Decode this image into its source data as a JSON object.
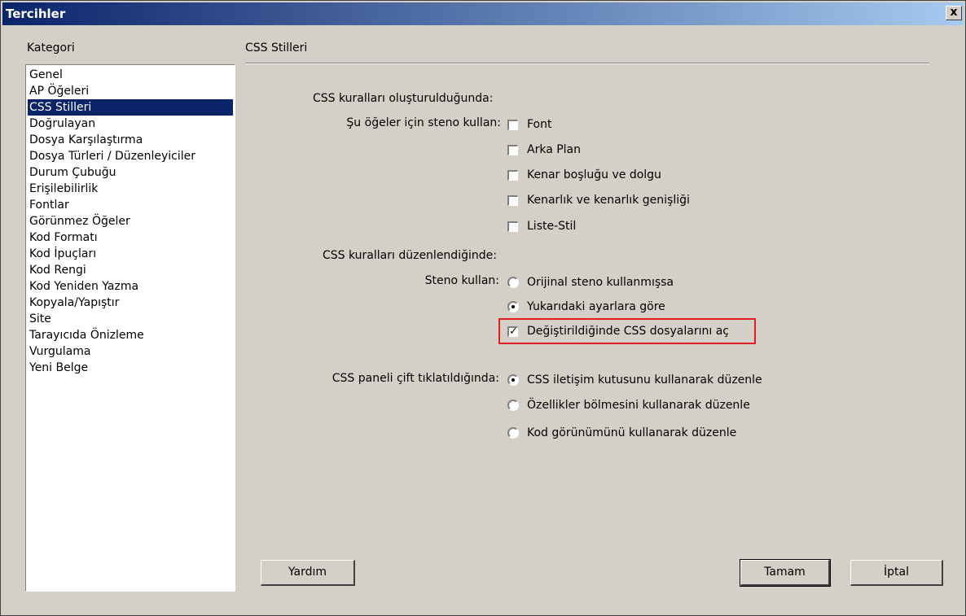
{
  "window": {
    "title": "Tercihler",
    "close_label": "x"
  },
  "category": {
    "label": "Kategori",
    "items": [
      "Genel",
      "AP Öğeleri",
      "CSS Stilleri",
      "Doğrulayan",
      "Dosya Karşılaştırma",
      "Dosya Türleri / Düzenleyiciler",
      "Durum Çubuğu",
      "Erişilebilirlik",
      "Fontlar",
      "Görünmez Öğeler",
      "Kod Formatı",
      "Kod İpuçları",
      "Kod Rengi",
      "Kod Yeniden Yazma",
      "Kopyala/Yapıştır",
      "Site",
      "Tarayıcıda Önizleme",
      "Vurgulama",
      "Yeni Belge"
    ],
    "selected": "CSS Stilleri"
  },
  "panel": {
    "title": "CSS Stilleri",
    "create_heading": "CSS kuralları oluşturulduğunda:",
    "shorthand_label": "Şu öğeler için steno kullan:",
    "shorthand_options": [
      {
        "label": "Font",
        "checked": false
      },
      {
        "label": "Arka Plan",
        "checked": false
      },
      {
        "label": "Kenar boşluğu ve dolgu",
        "checked": false
      },
      {
        "label": "Kenarlık ve kenarlık genişliği",
        "checked": false
      },
      {
        "label": "Liste-Stil",
        "checked": false
      }
    ],
    "edit_heading": "CSS kuralları düzenlendiğinde:",
    "steno_label": "Steno kullan:",
    "steno_options": [
      {
        "label": "Orijinal steno kullanmışsa",
        "checked": false
      },
      {
        "label": "Yukarıdaki ayarlara göre",
        "checked": true
      }
    ],
    "open_css_label": "Değiştirildiğinde CSS dosyalarını aç",
    "open_css_checked": true,
    "dblclick_label": "CSS paneli çift tıklatıldığında:",
    "dblclick_options": [
      {
        "label": "CSS iletişim kutusunu kullanarak düzenle",
        "checked": true
      },
      {
        "label": "Özellikler bölmesini kullanarak düzenle",
        "checked": false
      },
      {
        "label": "Kod görünümünü kullanarak düzenle",
        "checked": false
      }
    ]
  },
  "buttons": {
    "help": "Yardım",
    "ok": "Tamam",
    "cancel": "İptal"
  },
  "colors": {
    "highlight": "#e02020",
    "selection": "#0a246a"
  }
}
